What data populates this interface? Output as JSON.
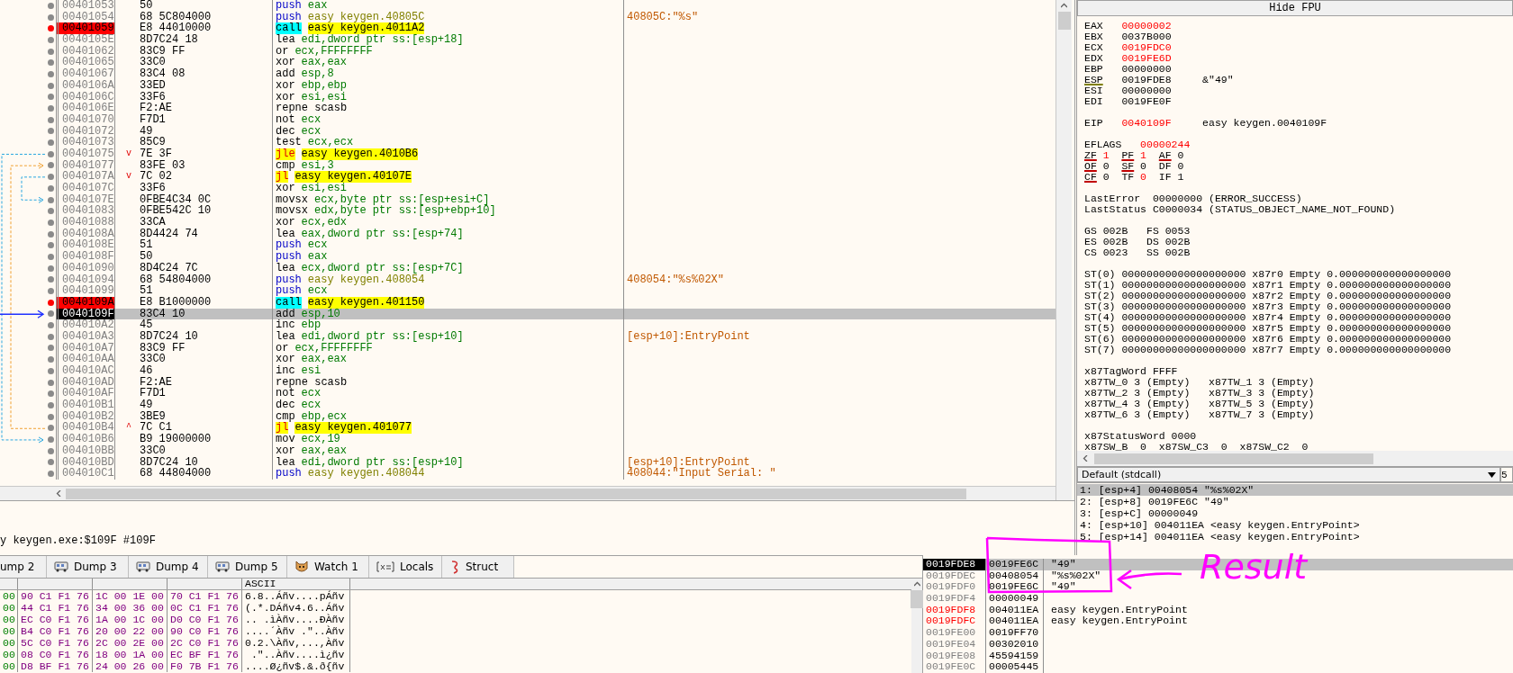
{
  "disassembly": {
    "rows": [
      {
        "address": "00401053",
        "bytes": "50",
        "mnemonic": "push",
        "operands": "eax",
        "kind": "push",
        "breakpoint": false,
        "current": false
      },
      {
        "address": "00401054",
        "bytes": "68 5C804000",
        "mnemonic": "push",
        "operands": "easy keygen.40805C",
        "comment": "40805C:\"%s\"",
        "kind": "push_label",
        "breakpoint": false,
        "current": false
      },
      {
        "address": "00401059",
        "bytes": "E8 44010000",
        "mnemonic": "call",
        "operands": "easy keygen.4011A2",
        "kind": "call",
        "breakpoint": true,
        "current": false
      },
      {
        "address": "0040105E",
        "bytes": "8D7C24 18",
        "mnemonic": "lea",
        "operands": "edi,dword ptr ss:[esp+18]",
        "kind": "normal",
        "breakpoint": false,
        "current": false
      },
      {
        "address": "00401062",
        "bytes": "83C9 FF",
        "mnemonic": "or",
        "operands": "ecx,FFFFFFFF",
        "kind": "normal",
        "breakpoint": false,
        "current": false
      },
      {
        "address": "00401065",
        "bytes": "33C0",
        "mnemonic": "xor",
        "operands": "eax,eax",
        "kind": "normal",
        "breakpoint": false,
        "current": false
      },
      {
        "address": "00401067",
        "bytes": "83C4 08",
        "mnemonic": "add",
        "operands": "esp,8",
        "kind": "normal",
        "breakpoint": false,
        "current": false
      },
      {
        "address": "0040106A",
        "bytes": "33ED",
        "mnemonic": "xor",
        "operands": "ebp,ebp",
        "kind": "normal",
        "breakpoint": false,
        "current": false
      },
      {
        "address": "0040106C",
        "bytes": "33F6",
        "mnemonic": "xor",
        "operands": "esi,esi",
        "kind": "normal",
        "breakpoint": false,
        "current": false
      },
      {
        "address": "0040106E",
        "bytes": "F2:AE",
        "mnemonic": "repne scasb",
        "kind": "normal",
        "breakpoint": false,
        "current": false
      },
      {
        "address": "00401070",
        "bytes": "F7D1",
        "mnemonic": "not",
        "operands": "ecx",
        "kind": "normal",
        "breakpoint": false,
        "current": false
      },
      {
        "address": "00401072",
        "bytes": "49",
        "mnemonic": "dec",
        "operands": "ecx",
        "kind": "normal",
        "breakpoint": false,
        "current": false
      },
      {
        "address": "00401073",
        "bytes": "85C9",
        "mnemonic": "test",
        "operands": "ecx,ecx",
        "kind": "normal",
        "breakpoint": false,
        "current": false
      },
      {
        "address": "00401075",
        "jump_mark": "v",
        "bytes": "7E 3F",
        "mnemonic": "jle",
        "operands": "easy keygen.4010B6",
        "kind": "jump",
        "breakpoint": false,
        "current": false
      },
      {
        "address": "00401077",
        "bytes": "83FE 03",
        "mnemonic": "cmp",
        "operands": "esi,3",
        "kind": "normal",
        "breakpoint": false,
        "current": false
      },
      {
        "address": "0040107A",
        "jump_mark": "v",
        "bytes": "7C 02",
        "mnemonic": "jl",
        "operands": "easy keygen.40107E",
        "kind": "jump",
        "breakpoint": false,
        "current": false
      },
      {
        "address": "0040107C",
        "bytes": "33F6",
        "mnemonic": "xor",
        "operands": "esi,esi",
        "kind": "normal",
        "breakpoint": false,
        "current": false
      },
      {
        "address": "0040107E",
        "bytes": "0FBE4C34 0C",
        "mnemonic": "movsx",
        "operands": "ecx,byte ptr ss:[esp+esi+C]",
        "kind": "normal",
        "breakpoint": false,
        "current": false
      },
      {
        "address": "00401083",
        "bytes": "0FBE542C 10",
        "mnemonic": "movsx",
        "operands": "edx,byte ptr ss:[esp+ebp+10]",
        "kind": "normal",
        "breakpoint": false,
        "current": false
      },
      {
        "address": "00401088",
        "bytes": "33CA",
        "mnemonic": "xor",
        "operands": "ecx,edx",
        "kind": "normal",
        "breakpoint": false,
        "current": false
      },
      {
        "address": "0040108A",
        "bytes": "8D4424 74",
        "mnemonic": "lea",
        "operands": "eax,dword ptr ss:[esp+74]",
        "kind": "normal",
        "breakpoint": false,
        "current": false
      },
      {
        "address": "0040108E",
        "bytes": "51",
        "mnemonic": "push",
        "operands": "ecx",
        "kind": "push",
        "breakpoint": false,
        "current": false
      },
      {
        "address": "0040108F",
        "bytes": "50",
        "mnemonic": "push",
        "operands": "eax",
        "kind": "push",
        "breakpoint": false,
        "current": false
      },
      {
        "address": "00401090",
        "bytes": "8D4C24 7C",
        "mnemonic": "lea",
        "operands": "ecx,dword ptr ss:[esp+7C]",
        "kind": "normal",
        "breakpoint": false,
        "current": false
      },
      {
        "address": "00401094",
        "bytes": "68 54804000",
        "mnemonic": "push",
        "operands": "easy keygen.408054",
        "comment": "408054:\"%s%02X\"",
        "kind": "push_label",
        "breakpoint": false,
        "current": false
      },
      {
        "address": "00401099",
        "bytes": "51",
        "mnemonic": "push",
        "operands": "ecx",
        "kind": "push",
        "breakpoint": false,
        "current": false
      },
      {
        "address": "0040109A",
        "bytes": "E8 B1000000",
        "mnemonic": "call",
        "operands": "easy keygen.401150",
        "kind": "call",
        "breakpoint": true,
        "current": false
      },
      {
        "address": "0040109F",
        "bytes": "83C4 10",
        "mnemonic": "add",
        "operands": "esp,10",
        "kind": "normal",
        "breakpoint": false,
        "current": true
      },
      {
        "address": "004010A2",
        "bytes": "45",
        "mnemonic": "inc",
        "operands": "ebp",
        "kind": "normal",
        "breakpoint": false,
        "current": false
      },
      {
        "address": "004010A3",
        "bytes": "8D7C24 10",
        "mnemonic": "lea",
        "operands": "edi,dword ptr ss:[esp+10]",
        "comment": "[esp+10]:EntryPoint",
        "kind": "normal",
        "breakpoint": false,
        "current": false
      },
      {
        "address": "004010A7",
        "bytes": "83C9 FF",
        "mnemonic": "or",
        "operands": "ecx,FFFFFFFF",
        "kind": "normal",
        "breakpoint": false,
        "current": false
      },
      {
        "address": "004010AA",
        "bytes": "33C0",
        "mnemonic": "xor",
        "operands": "eax,eax",
        "kind": "normal",
        "breakpoint": false,
        "current": false
      },
      {
        "address": "004010AC",
        "bytes": "46",
        "mnemonic": "inc",
        "operands": "esi",
        "kind": "normal",
        "breakpoint": false,
        "current": false
      },
      {
        "address": "004010AD",
        "bytes": "F2:AE",
        "mnemonic": "repne scasb",
        "kind": "normal",
        "breakpoint": false,
        "current": false
      },
      {
        "address": "004010AF",
        "bytes": "F7D1",
        "mnemonic": "not",
        "operands": "ecx",
        "kind": "normal",
        "breakpoint": false,
        "current": false
      },
      {
        "address": "004010B1",
        "bytes": "49",
        "mnemonic": "dec",
        "operands": "ecx",
        "kind": "normal",
        "breakpoint": false,
        "current": false
      },
      {
        "address": "004010B2",
        "bytes": "3BE9",
        "mnemonic": "cmp",
        "operands": "ebp,ecx",
        "kind": "normal",
        "breakpoint": false,
        "current": false
      },
      {
        "address": "004010B4",
        "jump_mark": "^",
        "bytes": "7C C1",
        "mnemonic": "jl",
        "operands": "easy keygen.401077",
        "kind": "jump",
        "breakpoint": false,
        "current": false
      },
      {
        "address": "004010B6",
        "bytes": "B9 19000000",
        "mnemonic": "mov",
        "operands": "ecx,19",
        "kind": "normal",
        "breakpoint": false,
        "current": false
      },
      {
        "address": "004010BB",
        "bytes": "33C0",
        "mnemonic": "xor",
        "operands": "eax,eax",
        "kind": "normal",
        "breakpoint": false,
        "current": false
      },
      {
        "address": "004010BD",
        "bytes": "8D7C24 10",
        "mnemonic": "lea",
        "operands": "edi,dword ptr ss:[esp+10]",
        "comment": "[esp+10]:EntryPoint",
        "kind": "normal",
        "breakpoint": false,
        "current": false
      },
      {
        "address": "004010C1",
        "bytes": "68 44804000",
        "mnemonic": "push",
        "operands": "easy keygen.408044",
        "comment": "408044:\"Input Serial: \"",
        "kind": "push_label",
        "breakpoint": false,
        "current": false
      }
    ]
  },
  "status_line": "y keygen.exe:$109F #109F",
  "hide_fpu_button": "Hide FPU",
  "registers": {
    "general": [
      {
        "name": "EAX",
        "value": "00000002",
        "changed": true,
        "underlined": false
      },
      {
        "name": "EBX",
        "value": "0037B000",
        "changed": false,
        "underlined": false
      },
      {
        "name": "ECX",
        "value": "0019FDC0",
        "changed": true,
        "underlined": false
      },
      {
        "name": "EDX",
        "value": "0019FE6D",
        "changed": true,
        "underlined": false
      },
      {
        "name": "EBP",
        "value": "00000000",
        "changed": false,
        "underlined": false
      },
      {
        "name": "ESP",
        "value": "0019FDE8",
        "comment": "&\"49\"",
        "changed": false,
        "underlined": true
      },
      {
        "name": "ESI",
        "value": "00000000",
        "changed": false,
        "underlined": false
      },
      {
        "name": "EDI",
        "value": "0019FE0F",
        "changed": false,
        "underlined": false
      }
    ],
    "eip": {
      "name": "EIP",
      "value": "0040109F",
      "comment": "easy keygen.0040109F",
      "changed": true
    },
    "eflags": {
      "name": "EFLAGS",
      "value": "00000244",
      "changed": true
    },
    "flag_rows": [
      [
        {
          "name": "ZF",
          "value": "1",
          "changed": true,
          "underlined": true
        },
        {
          "name": "PF",
          "value": "1",
          "changed": true,
          "underlined": true
        },
        {
          "name": "AF",
          "value": "0",
          "changed": false,
          "underlined": true
        }
      ],
      [
        {
          "name": "OF",
          "value": "0",
          "changed": false,
          "underlined": true
        },
        {
          "name": "SF",
          "value": "0",
          "changed": false,
          "underlined": true
        },
        {
          "name": "DF",
          "value": "0",
          "changed": false,
          "underlined": false
        }
      ],
      [
        {
          "name": "CF",
          "value": "0",
          "changed": false,
          "underlined": true
        },
        {
          "name": "TF",
          "value": "0",
          "changed": true,
          "underlined": false
        },
        {
          "name": "IF",
          "value": "1",
          "changed": false,
          "underlined": false
        }
      ]
    ],
    "last_error": [
      "LastError  00000000 (ERROR_SUCCESS)",
      "LastStatus C0000034 (STATUS_OBJECT_NAME_NOT_FOUND)"
    ],
    "segments": [
      "GS 002B   FS 0053",
      "ES 002B   DS 002B",
      "CS 0023   SS 002B"
    ],
    "fpu": [
      "ST(0) 00000000000000000000 x87r0 Empty 0.000000000000000000",
      "ST(1) 00000000000000000000 x87r1 Empty 0.000000000000000000",
      "ST(2) 00000000000000000000 x87r2 Empty 0.000000000000000000",
      "ST(3) 00000000000000000000 x87r3 Empty 0.000000000000000000",
      "ST(4) 00000000000000000000 x87r4 Empty 0.000000000000000000",
      "ST(5) 00000000000000000000 x87r5 Empty 0.000000000000000000",
      "ST(6) 00000000000000000000 x87r6 Empty 0.000000000000000000",
      "ST(7) 00000000000000000000 x87r7 Empty 0.000000000000000000"
    ],
    "tag_word": [
      "x87TagWord FFFF",
      "x87TW_0 3 (Empty)   x87TW_1 3 (Empty)",
      "x87TW_2 3 (Empty)   x87TW_3 3 (Empty)",
      "x87TW_4 3 (Empty)   x87TW_5 3 (Empty)",
      "x87TW_6 3 (Empty)   x87TW_7 3 (Empty)"
    ],
    "status_word": [
      "x87StatusWord 0000",
      "x87SW_B  0  x87SW_C3  0  x87SW_C2  0"
    ]
  },
  "call_convention": {
    "value": "Default (stdcall)",
    "count": "5"
  },
  "arguments": [
    {
      "text": "1: [esp+4] 00408054 \"%s%02X\"",
      "selected": true
    },
    {
      "text": "2: [esp+8] 0019FE6C \"49\"",
      "selected": false
    },
    {
      "text": "3: [esp+C] 00000049",
      "selected": false
    },
    {
      "text": "4: [esp+10] 004011EA <easy keygen.EntryPoint>",
      "selected": false
    },
    {
      "text": "5: [esp+14] 004011EA <easy keygen.EntryPoint>",
      "selected": false
    }
  ],
  "bottom_tabs": [
    {
      "label": "ump 2",
      "kind": "cut"
    },
    {
      "label": "Dump 3",
      "kind": "dump"
    },
    {
      "label": "Dump 4",
      "kind": "dump"
    },
    {
      "label": "Dump 5",
      "kind": "dump"
    },
    {
      "label": "Watch 1",
      "kind": "watch"
    },
    {
      "label": "Locals",
      "kind": "locals"
    },
    {
      "label": "Struct",
      "kind": "struct"
    }
  ],
  "dump": {
    "ascii_header": "ASCII",
    "rows": [
      {
        "column_1": "00",
        "hex": [
          "90 C1 F1 76",
          "1C 00 1E 00",
          "70 C1 F1 76"
        ],
        "ascii": "6.8..Áñv....pÁñv"
      },
      {
        "column_1": "00",
        "hex": [
          "44 C1 F1 76",
          "34 00 36 00",
          "0C C1 F1 76"
        ],
        "ascii": "(.*.DÁñv4.6..Áñv"
      },
      {
        "column_1": "00",
        "hex": [
          "EC C0 F1 76",
          "1A 00 1C 00",
          "D0 C0 F1 76"
        ],
        "ascii": ".. .ìÀñv....ÐÀñv"
      },
      {
        "column_1": "00",
        "hex": [
          "B4 C0 F1 76",
          "20 00 22 00",
          "90 C0 F1 76"
        ],
        "ascii": "....´Àñv .\"..Àñv"
      },
      {
        "column_1": "00",
        "hex": [
          "5C C0 F1 76",
          "2C 00 2E 00",
          "2C C0 F1 76"
        ],
        "ascii": "0.2.\\Àñv,...,Àñv"
      },
      {
        "column_1": "00",
        "hex": [
          "08 C0 F1 76",
          "18 00 1A 00",
          "EC BF F1 76"
        ],
        "ascii": " .\"..Àñv....ì¿ñv"
      },
      {
        "column_1": "00",
        "hex": [
          "D8 BF F1 76",
          "24 00 26 00",
          "F0 7B F1 76"
        ],
        "ascii": "....Ø¿ñv$.&.ð{ñv"
      }
    ]
  },
  "stack": [
    {
      "address": "0019FDE8",
      "value": "0019FE6C",
      "comment": "\"49\"",
      "selected": true,
      "highlighted": false
    },
    {
      "address": "0019FDEC",
      "value": "00408054",
      "comment": "\"%s%02X\"",
      "selected": false,
      "highlighted": false
    },
    {
      "address": "0019FDF0",
      "value": "0019FE6C",
      "comment": "\"49\"",
      "selected": false,
      "highlighted": false
    },
    {
      "address": "0019FDF4",
      "value": "00000049",
      "selected": false,
      "highlighted": false
    },
    {
      "address": "0019FDF8",
      "value": "004011EA",
      "comment": "easy keygen.EntryPoint",
      "selected": false,
      "highlighted": true
    },
    {
      "address": "0019FDFC",
      "value": "004011EA",
      "comment": "easy keygen.EntryPoint",
      "selected": false,
      "highlighted": true
    },
    {
      "address": "0019FE00",
      "value": "0019FF70",
      "selected": false,
      "highlighted": false
    },
    {
      "address": "0019FE04",
      "value": "00302010",
      "selected": false,
      "highlighted": false
    },
    {
      "address": "0019FE08",
      "value": "45594159",
      "selected": false,
      "highlighted": false
    },
    {
      "address": "0019FE0C",
      "value": "00005445",
      "selected": false,
      "highlighted": false
    }
  ],
  "annotation": {
    "text": "Result"
  }
}
